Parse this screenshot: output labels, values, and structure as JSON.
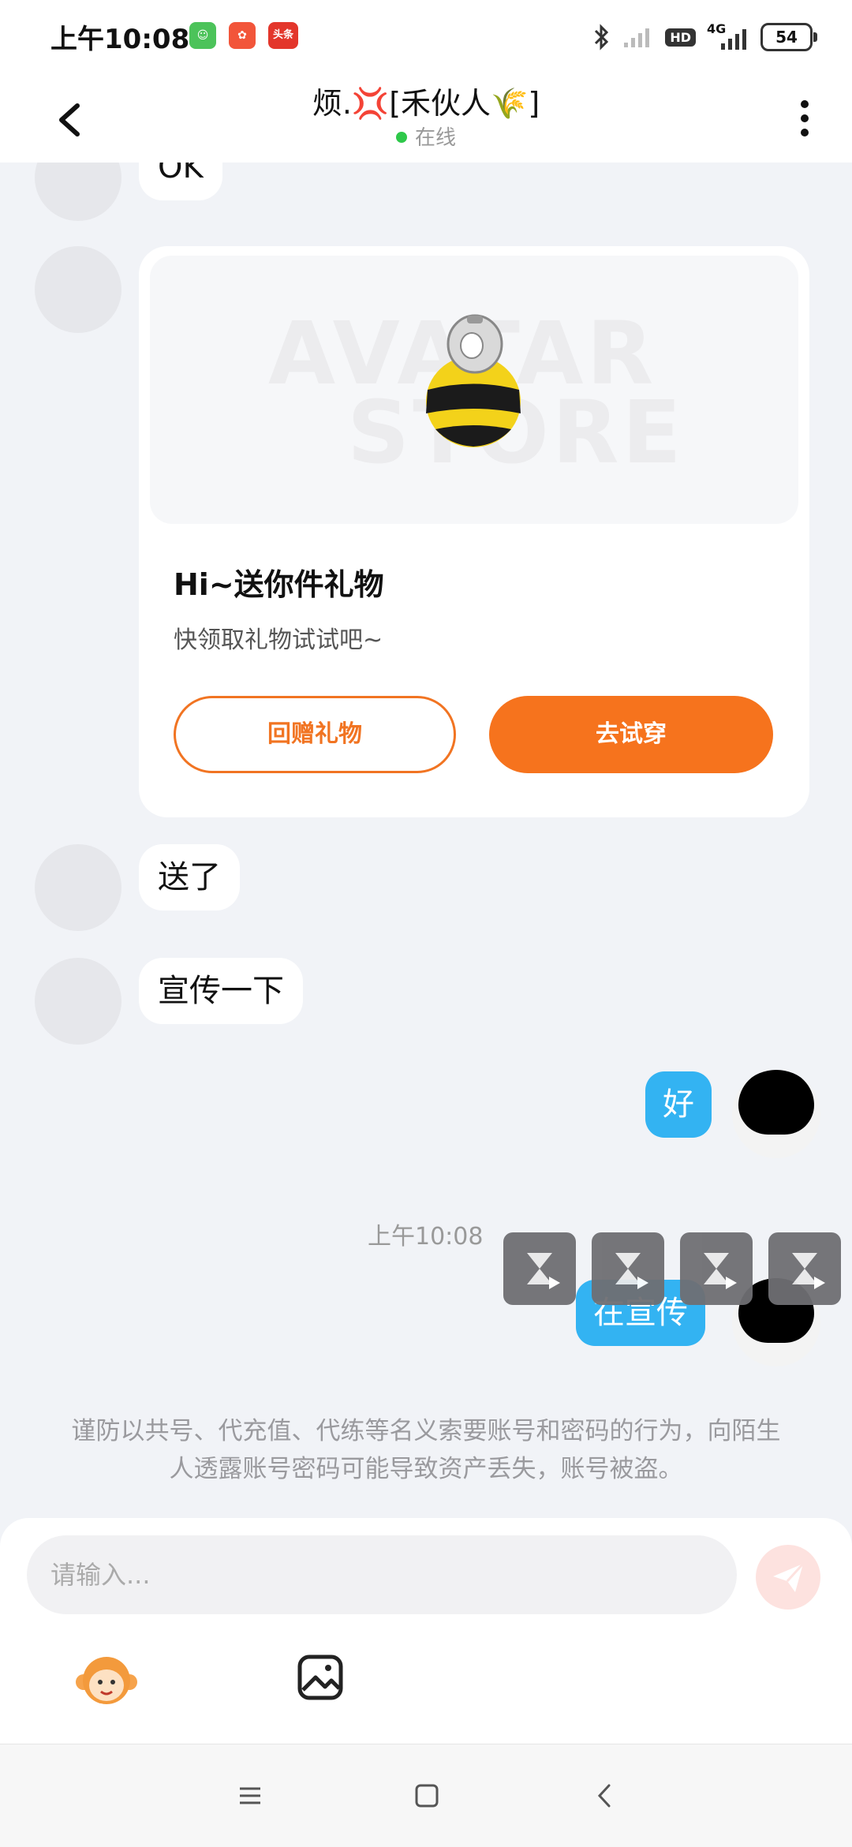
{
  "status_bar": {
    "time": "上午10:08",
    "app_icon_3_text": "头条",
    "network": "4G",
    "hd": "HD",
    "battery": "54"
  },
  "header": {
    "title": "烦.💢[禾伙人🌾]",
    "status": "在线"
  },
  "messages": {
    "m1": "OK",
    "gift": {
      "watermark_1": "AVATAR",
      "watermark_2": "STORE",
      "title": "Hi~送你件礼物",
      "subtitle": "快领取礼物试试吧~",
      "button_return_gift": "回赠礼物",
      "button_try_on": "去试穿"
    },
    "m2": "送了",
    "m3": "宣传一下",
    "m4": "好",
    "timestamp": "上午10:08",
    "m5": "在宣传"
  },
  "notice": "谨防以共号、代充值、代练等名义索要账号和密码的行为，向陌生人透露账号密码可能导致资产丢失，账号被盗。",
  "input": {
    "placeholder": "请输入..."
  },
  "colors": {
    "accent_orange": "#f6731d",
    "bubble_blue": "#33b3f2",
    "online_green": "#2ec84a"
  },
  "icons": {
    "back": "chevron-left-icon",
    "more": "more-vertical-icon",
    "send": "paper-plane-icon",
    "emoji": "monkey-emoji-icon",
    "image": "image-icon",
    "nav_menu": "menu-icon",
    "nav_home": "square-icon",
    "nav_back": "chevron-left-icon"
  }
}
